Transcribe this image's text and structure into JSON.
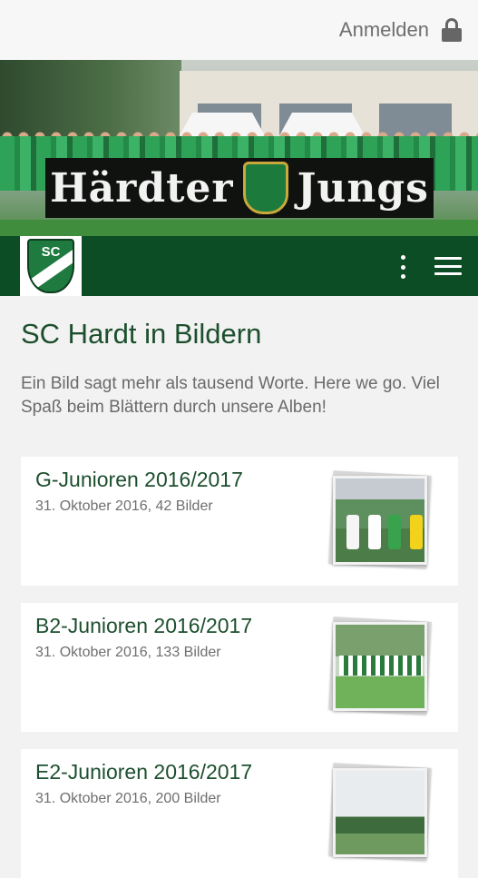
{
  "header": {
    "login_label": "Anmelden",
    "lock_icon": "lock-icon"
  },
  "hero": {
    "banner_left": "Härdter",
    "banner_right": "Jungs",
    "crest_text": "SC"
  },
  "navbar": {
    "logo_text": "SC",
    "background": "#0d4d25",
    "more_icon": "more-vertical-icon",
    "menu_icon": "hamburger-menu-icon"
  },
  "main": {
    "title": "SC Hardt in Bildern",
    "intro": "Ein Bild sagt mehr als tausend Worte. Here we go. Viel Spaß beim Blättern durch unsere Alben!"
  },
  "albums": [
    {
      "title": "G-Junioren 2016/2017",
      "meta": "31. Oktober 2016, 42 Bilder"
    },
    {
      "title": "B2-Junioren 2016/2017",
      "meta": "31. Oktober 2016, 133 Bilder"
    },
    {
      "title": "E2-Junioren 2016/2017",
      "meta": "31. Oktober 2016, 200 Bilder"
    }
  ],
  "colors": {
    "accent_green": "#0d4d25",
    "title_green": "#1d4f2e",
    "page_bg": "#f1f2f1"
  }
}
